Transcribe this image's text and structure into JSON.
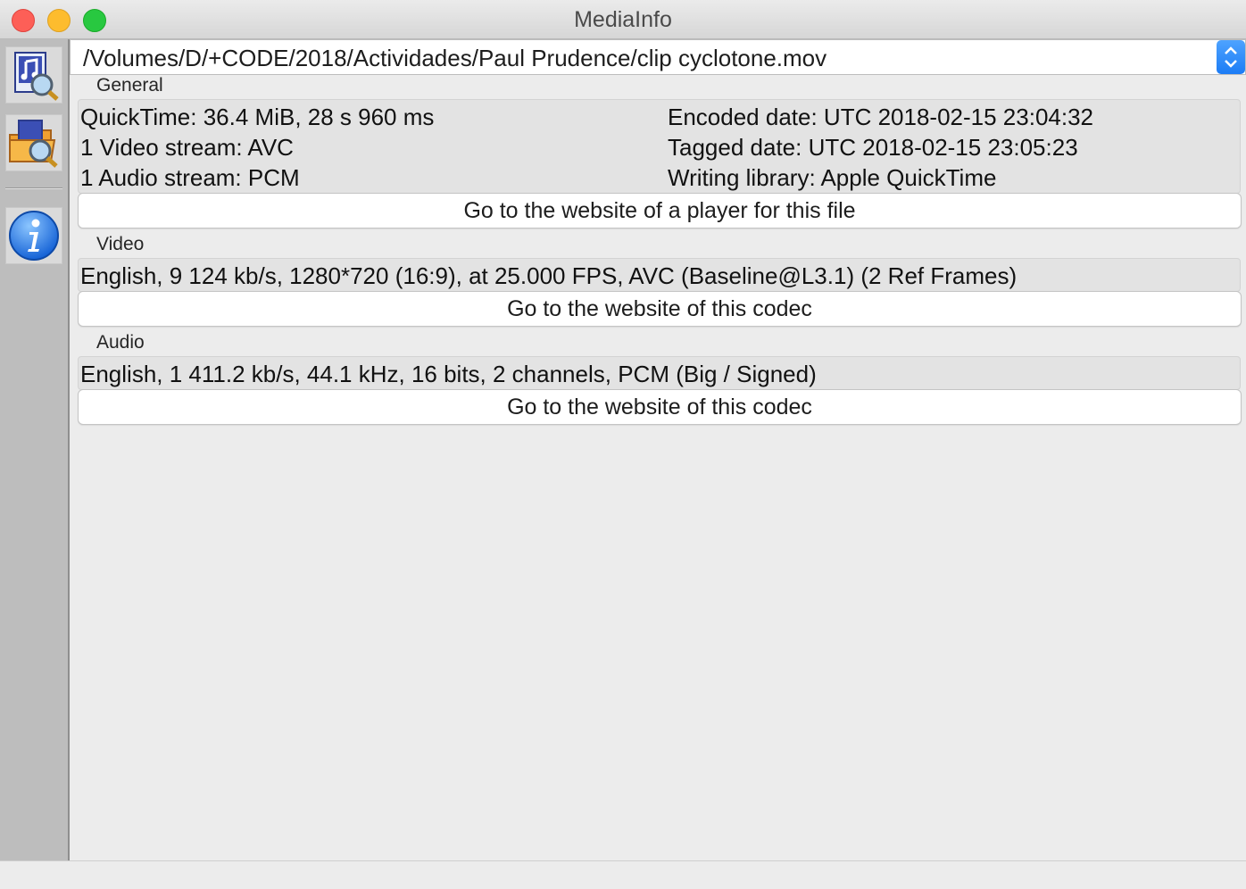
{
  "window": {
    "title": "MediaInfo"
  },
  "sidebar": {
    "buttons": [
      {
        "icon": "open-file-icon"
      },
      {
        "icon": "open-folder-icon"
      },
      {
        "icon": "info-icon"
      }
    ]
  },
  "file": {
    "path": "/Volumes/D/+CODE/2018/Actividades/Paul Prudence/clip cyclotone.mov"
  },
  "general": {
    "label": "General",
    "left": [
      "QuickTime: 36.4 MiB, 28 s 960 ms",
      "1 Video stream: AVC",
      "1 Audio stream: PCM"
    ],
    "right": [
      "Encoded date: UTC 2018-02-15 23:04:32",
      "Tagged date: UTC 2018-02-15 23:05:23",
      "Writing library: Apple QuickTime"
    ],
    "button": "Go to the website of a player for this file"
  },
  "video": {
    "label": "Video",
    "line": "English, 9 124 kb/s, 1280*720 (16:9), at 25.000 FPS, AVC (Baseline@L3.1) (2 Ref Frames)",
    "button": "Go to the website of this codec"
  },
  "audio": {
    "label": "Audio",
    "line": "English, 1 411.2 kb/s, 44.1 kHz, 16 bits, 2 channels, PCM (Big / Signed)",
    "button": "Go to the website of this codec"
  }
}
